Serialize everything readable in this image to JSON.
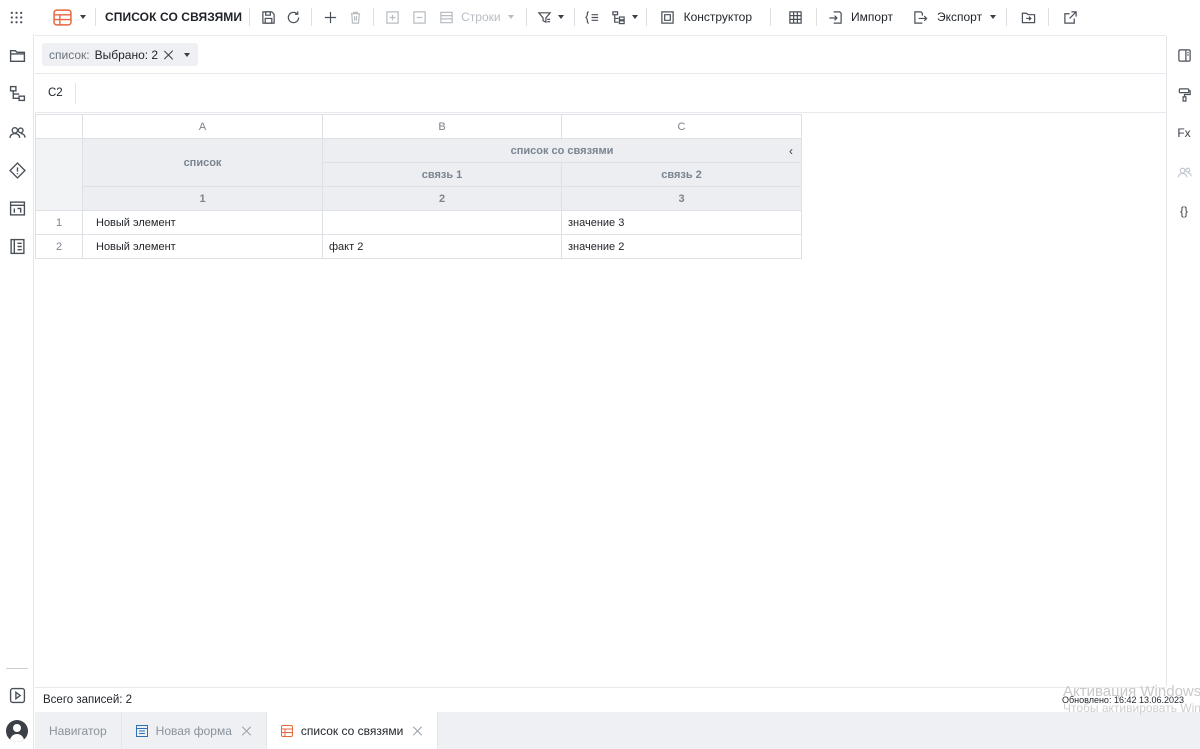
{
  "toolbar": {
    "title": "СПИСОК СО СВЯЗЯМИ",
    "rows_label": "Строки",
    "constructor_label": "Конструктор",
    "import_label": "Импорт",
    "export_label": "Экспорт"
  },
  "filter": {
    "key": "список:",
    "value": "Выбрано: 2"
  },
  "formula_bar": {
    "cell_ref": "C2"
  },
  "grid": {
    "columns": [
      "A",
      "B",
      "C"
    ],
    "header_main": "список",
    "header_group": "список со связями",
    "header_sub": [
      "связь 1",
      "связь 2"
    ],
    "col_numbers": [
      "1",
      "2",
      "3"
    ],
    "rows": [
      {
        "num": "1",
        "a": "Новый элемент",
        "b": "",
        "c": "значение 3"
      },
      {
        "num": "2",
        "a": "Новый элемент",
        "b": "факт 2",
        "c": "значение 2"
      }
    ]
  },
  "status": {
    "total": "Всего записей: 2",
    "updated": "Обновлено: 16:42 13.06.2023"
  },
  "tabs": [
    {
      "label": "Навигатор"
    },
    {
      "label": "Новая форма"
    },
    {
      "label": "список со связями"
    }
  ],
  "right_rail": {
    "fx_label": "Fx",
    "braces_label": "{}"
  },
  "watermark": {
    "line1": "Активация Windows",
    "line2": "Чтобы активировать Windows"
  },
  "colors": {
    "accent_orange": "#e8663d",
    "table_icon_blue": "#2f6fb5",
    "header_bg": "#eceef1"
  },
  "icons": [
    "apps-grid-icon",
    "folder-icon",
    "hierarchy-icon",
    "users-icon",
    "diamond-info-icon",
    "table-calendar-icon",
    "book-icon",
    "play-icon",
    "save-icon",
    "refresh-icon",
    "plus-icon",
    "trash-icon",
    "filter-icon",
    "bracket-list-icon",
    "tree-icon",
    "constructor-icon",
    "grid-icon",
    "import-icon",
    "export-icon",
    "folder-move-icon",
    "external-link-icon",
    "panel-icon",
    "paint-roller-icon",
    "users-disabled-icon"
  ]
}
